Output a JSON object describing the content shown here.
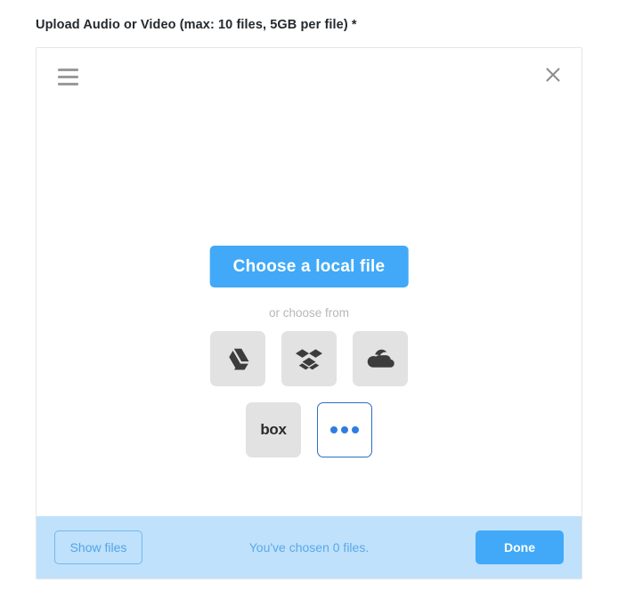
{
  "form": {
    "field_label": "Upload Audio or Video (max: 10 files, 5GB per file) *"
  },
  "picker": {
    "topbar": {
      "menu_icon": "hamburger-menu-icon",
      "close_icon": "close-icon"
    },
    "body": {
      "local_file_button": "Choose a local file",
      "or_text": "or choose from",
      "sources_row_1": [
        {
          "id": "googledrive",
          "label": "Google Drive",
          "icon": "google-drive-icon"
        },
        {
          "id": "dropbox",
          "label": "Dropbox",
          "icon": "dropbox-icon"
        },
        {
          "id": "onedrive",
          "label": "OneDrive",
          "icon": "onedrive-icon"
        }
      ],
      "sources_row_2": [
        {
          "id": "box",
          "label": "Box",
          "icon": "box-icon",
          "wordmark": "box"
        },
        {
          "id": "more",
          "label": "More sources",
          "icon": "more-dots-icon"
        }
      ]
    },
    "footer": {
      "show_files_label": "Show files",
      "chosen_status": "You've chosen 0 files.",
      "done_label": "Done"
    }
  },
  "colors": {
    "accent_blue": "#41a9f7",
    "footer_blue": "#bfe1fb",
    "footer_text_blue": "#5aa9e9",
    "tile_gray": "#e2e2e2",
    "more_border_blue": "#2a6fc4",
    "dot_blue": "#2f7de1",
    "icon_dark": "#3c3c3c",
    "muted_gray": "#b7b7b7"
  }
}
